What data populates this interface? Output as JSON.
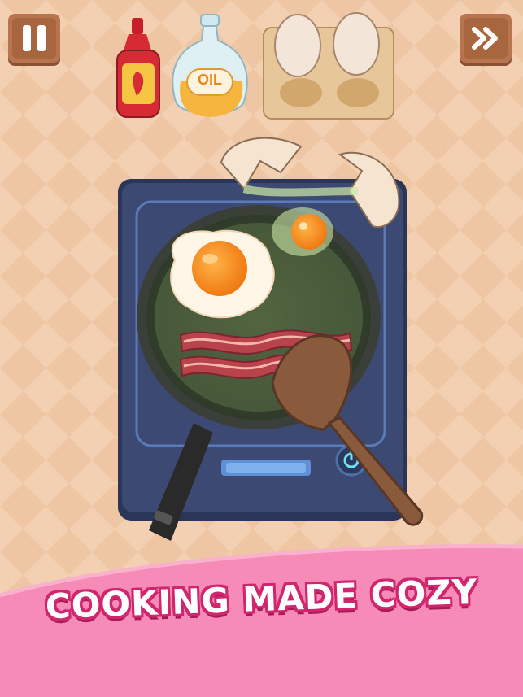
{
  "hud": {
    "pause_icon": "pause-icon",
    "skip_icon": "fast-forward-icon"
  },
  "ingredients": {
    "sauce_icon": "hot-sauce-bottle-icon",
    "oil_label": "OIL",
    "egg_tray_icon": "egg-tray-icon"
  },
  "tagline": "COOKING MADE COZY",
  "colors": {
    "background": "#efc6a3",
    "banner": "#f58bb6",
    "banner_text_outline": "#d1266e",
    "stove": "#3c4a73",
    "wood_button": "#b7744f"
  }
}
